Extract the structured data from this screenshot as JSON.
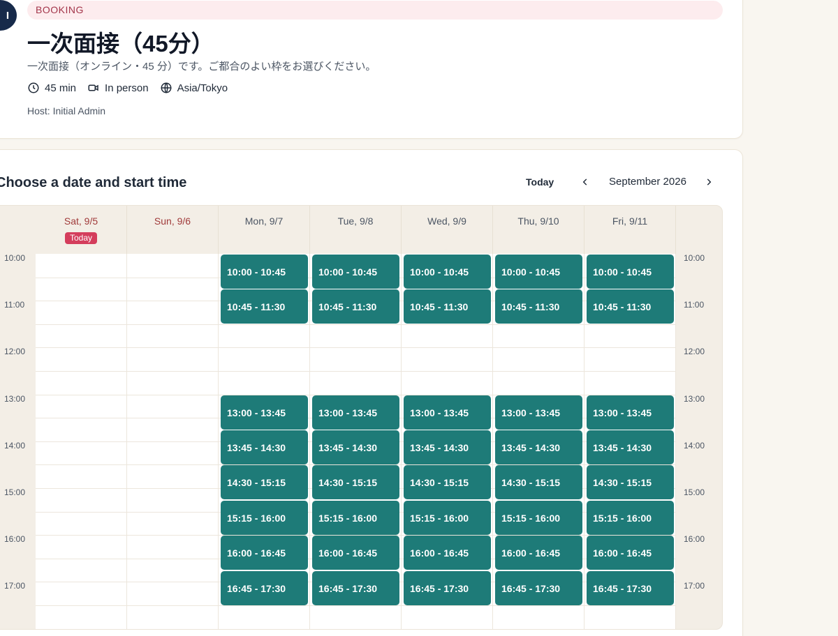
{
  "event": {
    "avatar_initial": "I",
    "badge": "BOOKING",
    "title": "一次面接（45分）",
    "description": "一次面接（オンライン・45 分）です。ご都合のよい枠をお選びください。",
    "duration": "45 min",
    "location": "In person",
    "timezone": "Asia/Tokyo",
    "host": "Host: Initial Admin"
  },
  "calendar": {
    "section_title": "Choose a date and start time",
    "today_button": "Today",
    "month_label": "September 2026",
    "today_badge": "Today",
    "days": [
      {
        "label": "Sat, 9/5",
        "weekend": true,
        "today": true,
        "slots": []
      },
      {
        "label": "Sun, 9/6",
        "weekend": true,
        "today": false,
        "slots": []
      },
      {
        "label": "Mon, 9/7",
        "weekend": false,
        "today": false,
        "slots": [
          "10:00 - 10:45",
          "10:45 - 11:30",
          "13:00 - 13:45",
          "13:45 - 14:30",
          "14:30 - 15:15",
          "15:15 - 16:00",
          "16:00 - 16:45",
          "16:45 - 17:30"
        ]
      },
      {
        "label": "Tue, 9/8",
        "weekend": false,
        "today": false,
        "slots": [
          "10:00 - 10:45",
          "10:45 - 11:30",
          "13:00 - 13:45",
          "13:45 - 14:30",
          "14:30 - 15:15",
          "15:15 - 16:00",
          "16:00 - 16:45",
          "16:45 - 17:30"
        ]
      },
      {
        "label": "Wed, 9/9",
        "weekend": false,
        "today": false,
        "slots": [
          "10:00 - 10:45",
          "10:45 - 11:30",
          "13:00 - 13:45",
          "13:45 - 14:30",
          "14:30 - 15:15",
          "15:15 - 16:00",
          "16:00 - 16:45",
          "16:45 - 17:30"
        ]
      },
      {
        "label": "Thu, 9/10",
        "weekend": false,
        "today": false,
        "slots": [
          "10:00 - 10:45",
          "10:45 - 11:30",
          "13:00 - 13:45",
          "13:45 - 14:30",
          "14:30 - 15:15",
          "15:15 - 16:00",
          "16:00 - 16:45",
          "16:45 - 17:30"
        ]
      },
      {
        "label": "Fri, 9/11",
        "weekend": false,
        "today": false,
        "slots": [
          "10:00 - 10:45",
          "10:45 - 11:30",
          "13:00 - 13:45",
          "13:45 - 14:30",
          "14:30 - 15:15",
          "15:15 - 16:00",
          "16:00 - 16:45",
          "16:45 - 17:30"
        ]
      }
    ],
    "hours": [
      "10:00",
      "11:00",
      "12:00",
      "13:00",
      "14:00",
      "15:00",
      "16:00",
      "17:00"
    ]
  },
  "colors": {
    "slot": "#1e7b78",
    "today_badge": "#d43d5c",
    "weekend_text": "#a03a3a",
    "avatar": "#172a4a"
  }
}
